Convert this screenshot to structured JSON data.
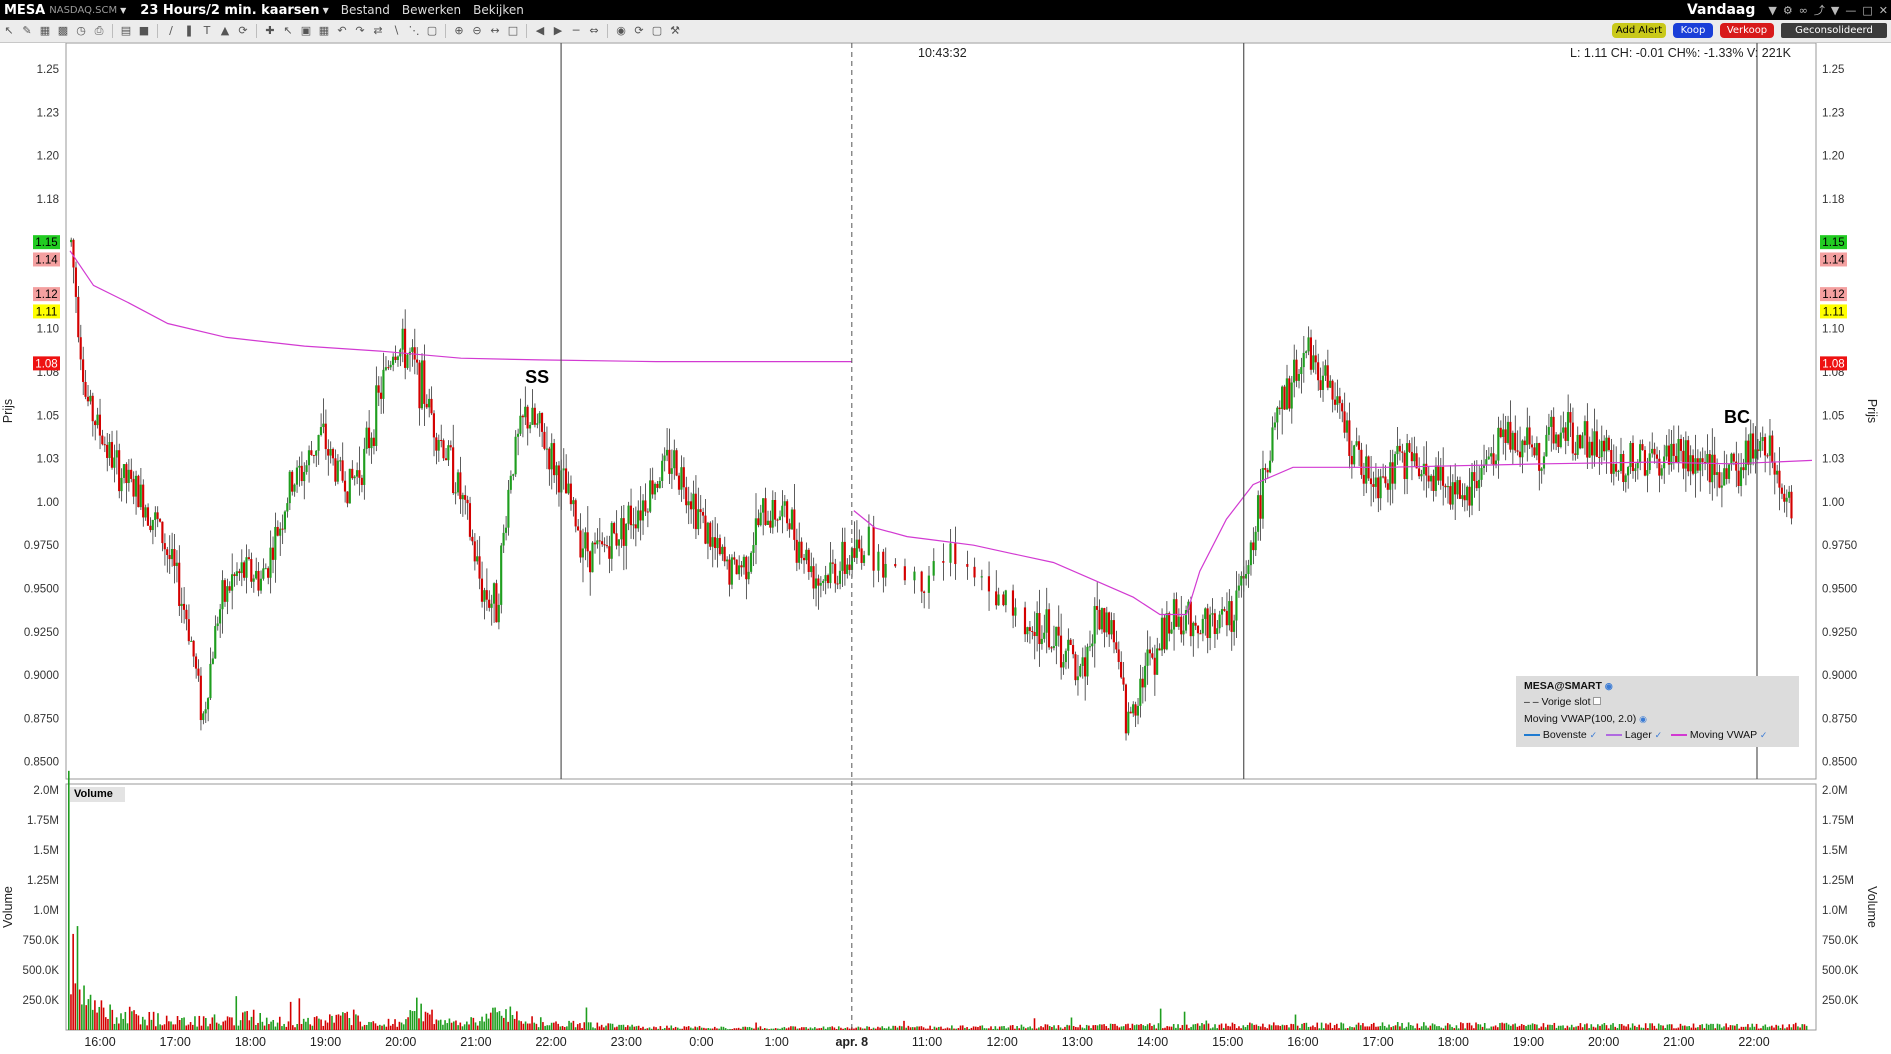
{
  "titlebar": {
    "symbol": "MESA",
    "exchange": "NASDAQ.SCM",
    "period": "23 Hours/2 min. kaarsen",
    "menus": [
      "Bestand",
      "Bewerken",
      "Bekijken"
    ],
    "range": "Vandaag"
  },
  "toolbar": {
    "add_alert": "Add Alert",
    "buy": "Koop",
    "sell": "Verkoop",
    "consolidated": "Geconsolideerd"
  },
  "colors": {
    "up": "#1f9e1f",
    "down": "#d40000",
    "vwap": "#d23ad2",
    "add_alert_bg": "#c9c91a",
    "buy_bg": "#1a3fd8",
    "sell_bg": "#d81a1a"
  },
  "crosshair": {
    "time": "10:43:32"
  },
  "info": "L: 1.11 CH: -0.01  CH%: -1.33% V: 221K",
  "price_axis": {
    "title": "Prijs",
    "ticks": [
      "1.25",
      "1.23",
      "1.20",
      "1.18",
      "1.10",
      "1.08",
      "1.05",
      "1.03",
      "1.00",
      "0.9750",
      "0.9500",
      "0.9250",
      "0.9000",
      "0.8750",
      "0.8500"
    ],
    "tick_values": [
      1.25,
      1.225,
      1.2,
      1.175,
      1.1,
      1.075,
      1.05,
      1.025,
      1.0,
      0.975,
      0.95,
      0.925,
      0.9,
      0.875,
      0.85
    ],
    "badges": [
      {
        "label": "1.15",
        "value": 1.15,
        "bg": "#22cc22",
        "fg": "#000000"
      },
      {
        "label": "1.14",
        "value": 1.14,
        "bg": "#f4a0a0",
        "fg": "#000000"
      },
      {
        "label": "1.12",
        "value": 1.12,
        "bg": "#f4a0a0",
        "fg": "#000000"
      },
      {
        "label": "1.11",
        "value": 1.11,
        "bg": "#ffff00",
        "fg": "#000000"
      },
      {
        "label": "1.08",
        "value": 1.08,
        "bg": "#ee1111",
        "fg": "#ffffff"
      }
    ]
  },
  "volume_axis": {
    "title": "Volume",
    "ticks": [
      "2.0M",
      "1.75M",
      "1.5M",
      "1.25M",
      "1.0M",
      "750.0K",
      "500.0K",
      "250.0K"
    ],
    "tick_values": [
      2000000,
      1750000,
      1500000,
      1250000,
      1000000,
      750000,
      500000,
      250000
    ]
  },
  "time_axis": {
    "labels": [
      "16:00",
      "17:00",
      "18:00",
      "19:00",
      "20:00",
      "21:00",
      "22:00",
      "23:00",
      "0:00",
      "1:00",
      "apr. 8",
      "11:00",
      "12:00",
      "13:00",
      "14:00",
      "15:00",
      "16:00",
      "17:00",
      "18:00",
      "19:00",
      "20:00",
      "21:00",
      "22:00"
    ],
    "bold": [
      "apr. 8"
    ]
  },
  "markers": [
    {
      "label": "SS",
      "time_index": 6
    },
    {
      "label": "BC",
      "time_index": 22
    }
  ],
  "legend": {
    "title": "MESA@SMART",
    "prev_close": "Vorige slot",
    "study": "Moving VWAP(100, 2.0)",
    "series": [
      "Bovenste",
      "Lager",
      "Moving VWAP"
    ]
  },
  "volume_tag": "Volume",
  "chart_data": {
    "type": "candlestick",
    "ylim": [
      0.84,
      1.265
    ],
    "volume_ylim": [
      0,
      2050000
    ],
    "price_path": [
      [
        0,
        1.15
      ],
      [
        1,
        1.06
      ],
      [
        2,
        1.04
      ],
      [
        3,
        1.02
      ],
      [
        4,
        1.01
      ],
      [
        5,
        1.0
      ],
      [
        6,
        0.985
      ],
      [
        7,
        0.96
      ],
      [
        8,
        0.93
      ],
      [
        9,
        0.875
      ],
      [
        10,
        0.935
      ],
      [
        11,
        0.955
      ],
      [
        12,
        0.96
      ],
      [
        13,
        0.955
      ],
      [
        14,
        0.98
      ],
      [
        15,
        1.01
      ],
      [
        16,
        1.02
      ],
      [
        17,
        1.04
      ],
      [
        18,
        1.02
      ],
      [
        19,
        1.01
      ],
      [
        20,
        1.025
      ],
      [
        21,
        1.06
      ],
      [
        22,
        1.09
      ],
      [
        23,
        1.085
      ],
      [
        24,
        1.065
      ],
      [
        25,
        1.04
      ],
      [
        26,
        1.02
      ],
      [
        27,
        0.99
      ],
      [
        28,
        0.95
      ],
      [
        29,
        0.94
      ],
      [
        30,
        1.02
      ],
      [
        31,
        1.05
      ],
      [
        32,
        1.04
      ],
      [
        33,
        1.02
      ],
      [
        34,
        1.0
      ],
      [
        35,
        0.975
      ],
      [
        36,
        0.97
      ],
      [
        37,
        0.98
      ],
      [
        38,
        0.99
      ],
      [
        39,
        1.0
      ],
      [
        40,
        1.015
      ],
      [
        41,
        1.025
      ],
      [
        42,
        1.01
      ],
      [
        43,
        0.99
      ],
      [
        44,
        0.97
      ],
      [
        45,
        0.96
      ],
      [
        46,
        0.965
      ],
      [
        47,
        0.99
      ],
      [
        48,
        0.995
      ],
      [
        49,
        0.99
      ],
      [
        50,
        0.97
      ],
      [
        51,
        0.955
      ],
      [
        52,
        0.96
      ],
      [
        53,
        0.965
      ],
      [
        54,
        0.975
      ],
      [
        55,
        0.97
      ],
      [
        56,
        0.96
      ],
      [
        57,
        0.955
      ],
      [
        58,
        0.955
      ],
      [
        59,
        0.96
      ],
      [
        60,
        0.965
      ],
      [
        61,
        0.96
      ],
      [
        62,
        0.955
      ],
      [
        63,
        0.95
      ],
      [
        64,
        0.935
      ],
      [
        65,
        0.925
      ],
      [
        66,
        0.93
      ],
      [
        67,
        0.92
      ],
      [
        68,
        0.91
      ],
      [
        69,
        0.905
      ],
      [
        70,
        0.935
      ],
      [
        71,
        0.93
      ],
      [
        72,
        0.87
      ],
      [
        73,
        0.9
      ],
      [
        74,
        0.915
      ],
      [
        75,
        0.93
      ],
      [
        76,
        0.935
      ],
      [
        77,
        0.93
      ],
      [
        78,
        0.93
      ],
      [
        79,
        0.935
      ],
      [
        80,
        0.95
      ],
      [
        81,
        1.0
      ],
      [
        82,
        1.04
      ],
      [
        83,
        1.06
      ],
      [
        84,
        1.085
      ],
      [
        85,
        1.08
      ],
      [
        86,
        1.06
      ],
      [
        87,
        1.04
      ],
      [
        88,
        1.02
      ],
      [
        89,
        1.015
      ],
      [
        90,
        1.02
      ],
      [
        91,
        1.025
      ],
      [
        92,
        1.02
      ],
      [
        93,
        1.015
      ],
      [
        94,
        1.01
      ],
      [
        95,
        1.005
      ],
      [
        96,
        1.015
      ],
      [
        97,
        1.03
      ],
      [
        98,
        1.04
      ],
      [
        99,
        1.035
      ],
      [
        100,
        1.03
      ],
      [
        101,
        1.035
      ],
      [
        102,
        1.04
      ],
      [
        103,
        1.035
      ],
      [
        104,
        1.03
      ],
      [
        105,
        1.025
      ],
      [
        106,
        1.02
      ],
      [
        107,
        1.025
      ],
      [
        108,
        1.02
      ],
      [
        109,
        1.03
      ],
      [
        110,
        1.025
      ],
      [
        111,
        1.02
      ],
      [
        112,
        1.015
      ],
      [
        113,
        1.02
      ],
      [
        114,
        1.02
      ],
      [
        115,
        1.04
      ],
      [
        116,
        1.03
      ],
      [
        117,
        1.0
      ],
      [
        118,
        0.99
      ]
    ],
    "vwap_segment_1": [
      [
        0,
        1.145
      ],
      [
        6,
        1.125
      ],
      [
        15,
        1.115
      ],
      [
        25,
        1.103
      ],
      [
        40,
        1.095
      ],
      [
        60,
        1.09
      ],
      [
        80,
        1.087
      ],
      [
        100,
        1.083
      ],
      [
        120,
        1.082
      ],
      [
        150,
        1.081
      ],
      [
        200,
        1.081
      ]
    ],
    "vwap_segment_2": [
      [
        0,
        0.995
      ],
      [
        8,
        0.985
      ],
      [
        20,
        0.98
      ],
      [
        30,
        0.978
      ],
      [
        45,
        0.975
      ],
      [
        60,
        0.97
      ],
      [
        75,
        0.965
      ],
      [
        90,
        0.955
      ],
      [
        105,
        0.945
      ],
      [
        115,
        0.935
      ],
      [
        125,
        0.935
      ],
      [
        130,
        0.96
      ],
      [
        140,
        0.99
      ],
      [
        150,
        1.01
      ],
      [
        165,
        1.02
      ],
      [
        200,
        1.02
      ],
      [
        260,
        1.022
      ],
      [
        300,
        1.023
      ],
      [
        330,
        1.022
      ],
      [
        360,
        1.024
      ]
    ],
    "volume_profile": [
      [
        0,
        2000000
      ],
      [
        1,
        700000
      ],
      [
        2,
        1500000
      ],
      [
        3,
        550000
      ],
      [
        4,
        600000
      ],
      [
        5,
        400000
      ],
      [
        6,
        350000
      ],
      [
        8,
        250000
      ],
      [
        12,
        200000
      ],
      [
        20,
        150000
      ],
      [
        40,
        100000
      ],
      [
        60,
        80000
      ],
      [
        90,
        120000
      ],
      [
        100,
        60000
      ],
      [
        120,
        90000
      ],
      [
        130,
        120000
      ],
      [
        140,
        60000
      ],
      [
        150,
        70000
      ],
      [
        160,
        200000
      ],
      [
        170,
        80000
      ],
      [
        180,
        60000
      ],
      [
        200,
        150000
      ],
      [
        220,
        60000
      ],
      [
        260,
        30000
      ],
      [
        300,
        20000
      ],
      [
        400,
        25000
      ],
      [
        500,
        40000
      ],
      [
        600,
        45000
      ],
      [
        700,
        40000
      ],
      [
        800,
        35000
      ]
    ]
  }
}
